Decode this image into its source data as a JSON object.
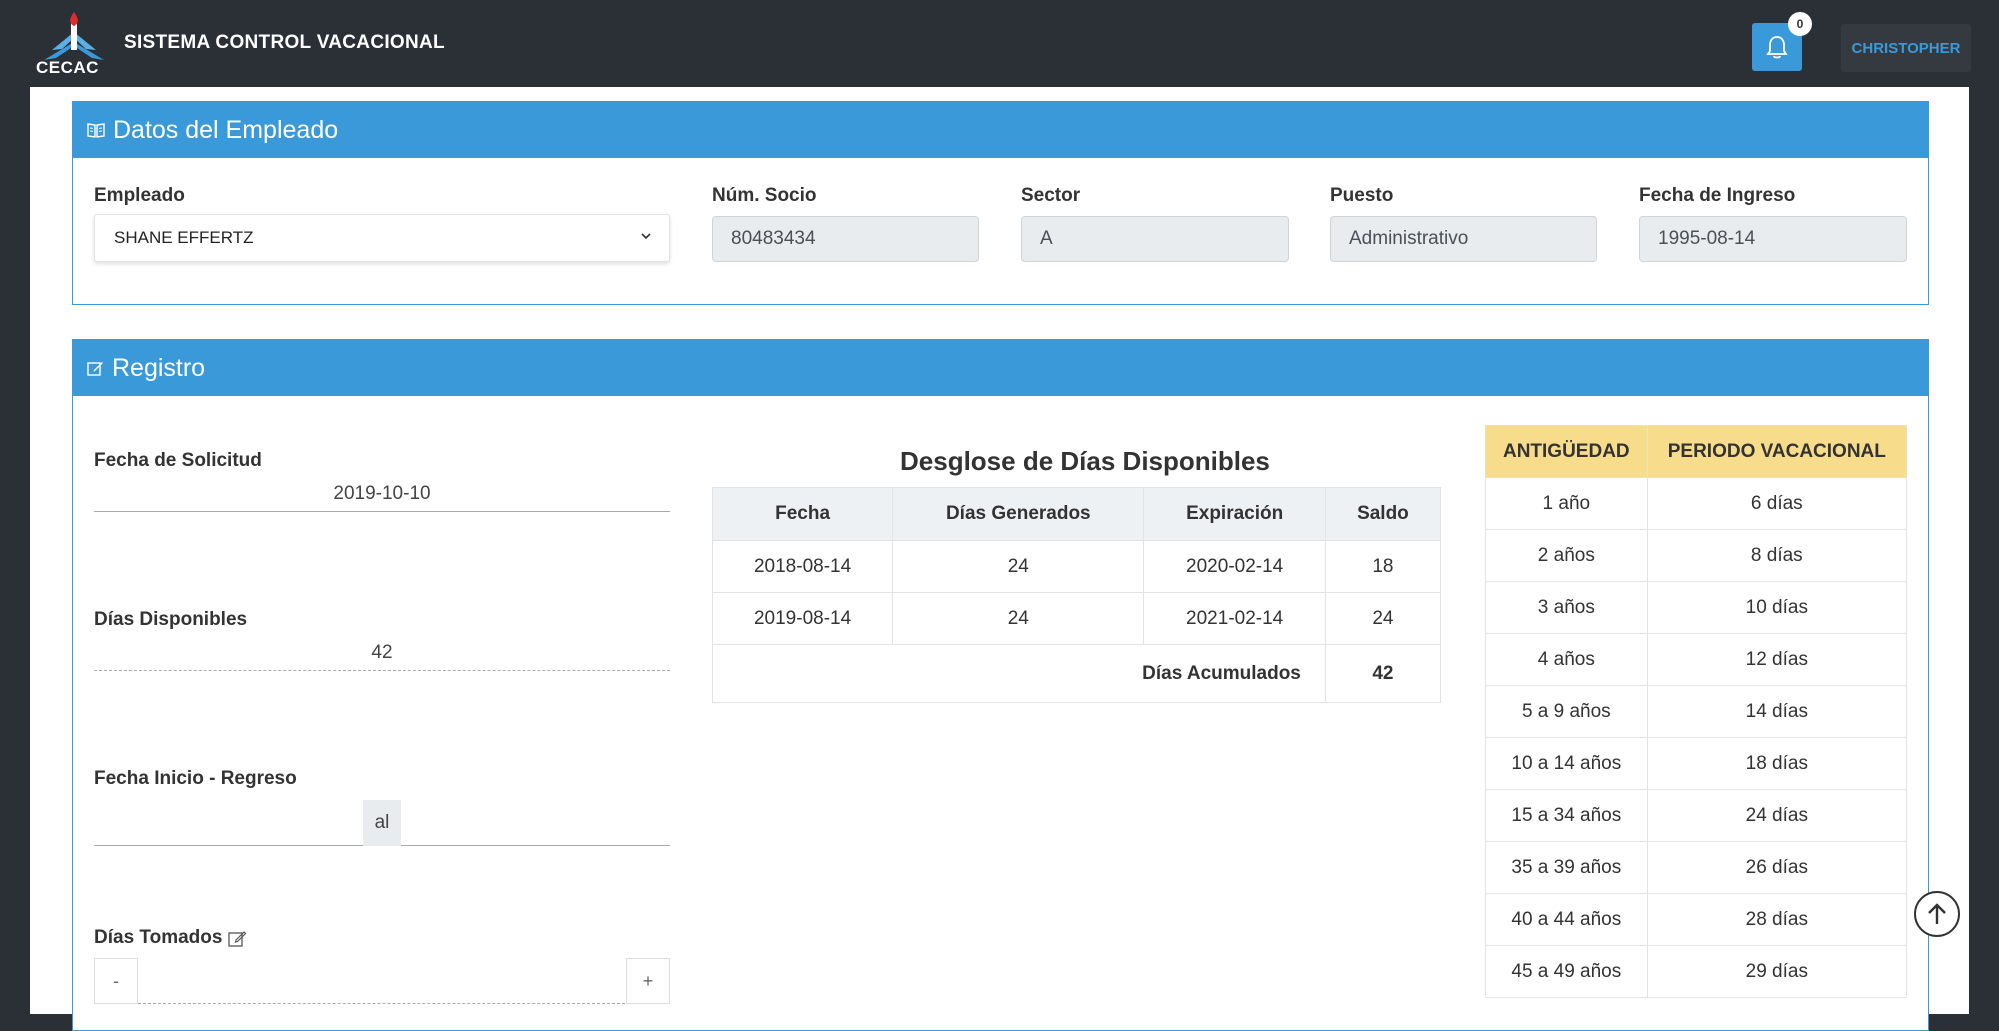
{
  "header": {
    "logo_text": "CECAC",
    "app_title": "SISTEMA CONTROL VACACIONAL",
    "notification_count": "0",
    "user_name": "CHRISTOPHER"
  },
  "employee_card": {
    "title": "Datos del Empleado",
    "empleado_label": "Empleado",
    "empleado_value": "SHANE EFFERTZ",
    "socio_label": "Núm. Socio",
    "socio_value": "80483434",
    "sector_label": "Sector",
    "sector_value": "A",
    "puesto_label": "Puesto",
    "puesto_value": "Administrativo",
    "ingreso_label": "Fecha de Ingreso",
    "ingreso_value": "1995-08-14"
  },
  "registro_card": {
    "title": "Registro",
    "solicitud_label": "Fecha de Solicitud",
    "solicitud_value": "2019-10-10",
    "disponibles_label": "Días Disponibles",
    "disponibles_value": "42",
    "inicio_regreso_label": "Fecha Inicio - Regreso",
    "al_text": "al",
    "tomados_label": "Días Tomados",
    "minus": "-",
    "plus": "+"
  },
  "breakdown": {
    "title": "Desglose de Días Disponibles",
    "headers": [
      "Fecha",
      "Días Generados",
      "Expiración",
      "Saldo"
    ],
    "rows": [
      [
        "2018-08-14",
        "24",
        "2020-02-14",
        "18"
      ],
      [
        "2019-08-14",
        "24",
        "2021-02-14",
        "24"
      ]
    ],
    "total_label": "Días Acumulados",
    "total_value": "42"
  },
  "seniority": {
    "headers": [
      "ANTIGÜEDAD",
      "PERIODO VACACIONAL"
    ],
    "rows": [
      [
        "1 año",
        "6 días"
      ],
      [
        "2 años",
        "8 días"
      ],
      [
        "3 años",
        "10 días"
      ],
      [
        "4 años",
        "12 días"
      ],
      [
        "5 a 9 años",
        "14 días"
      ],
      [
        "10 a 14 años",
        "18 días"
      ],
      [
        "15 a 34 años",
        "24 días"
      ],
      [
        "35 a 39 años",
        "26 días"
      ],
      [
        "40 a 44 años",
        "28 días"
      ],
      [
        "45 a 49 años",
        "29 días"
      ]
    ]
  },
  "colors": {
    "primary": "#3a9ad9",
    "navbar": "#2b3036",
    "table_header_yellow": "#f7dd8b"
  }
}
